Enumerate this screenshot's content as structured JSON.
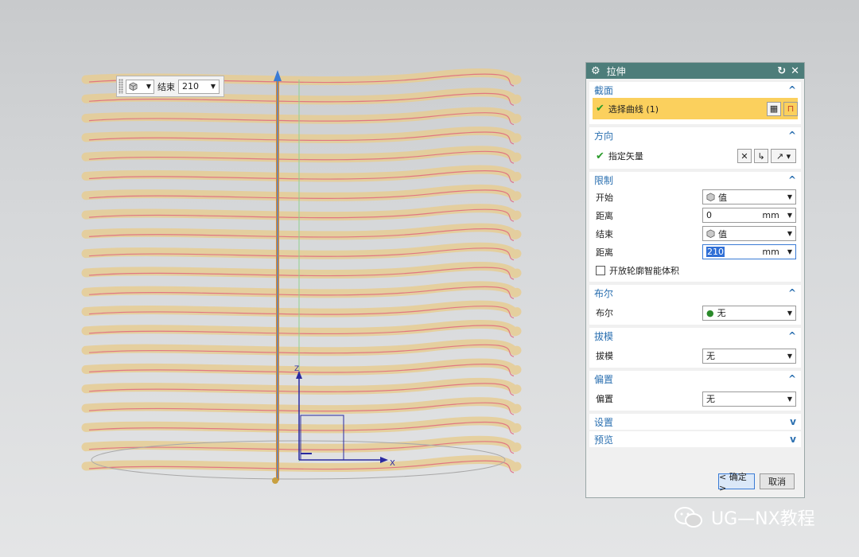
{
  "viewport": {
    "axes": {
      "z": "Z",
      "x": "X"
    }
  },
  "mini_toolbar": {
    "end_label": "结束",
    "end_value": "210"
  },
  "dialog": {
    "title": "拉伸",
    "sections": {
      "section": {
        "header": "截面",
        "select_curve": "选择曲线 (1)"
      },
      "direction": {
        "header": "方向",
        "specify_vector": "指定矢量"
      },
      "limits": {
        "header": "限制",
        "start_label": "开始",
        "start_type": "值",
        "start_distance_label": "距离",
        "start_distance": "0",
        "end_label": "结束",
        "end_type": "值",
        "end_distance_label": "距离",
        "end_distance": "210",
        "unit": "mm",
        "open_profile_label": "开放轮廓智能体积"
      },
      "boolean": {
        "header": "布尔",
        "label": "布尔",
        "value": "无"
      },
      "draft": {
        "header": "拔模",
        "label": "拔模",
        "value": "无"
      },
      "offset": {
        "header": "偏置",
        "label": "偏置",
        "value": "无"
      },
      "settings": {
        "header": "设置"
      },
      "preview": {
        "header": "预览"
      }
    },
    "ok_label": "< 确定 >",
    "cancel_label": "取消"
  },
  "watermark": {
    "text": "UG—NX教程"
  },
  "colors": {
    "title_bar": "#4d7d7a",
    "section_header": "#2a6fb0",
    "highlight": "#fbd05d",
    "coil": "#e6cc93",
    "curve": "#e0607a"
  }
}
